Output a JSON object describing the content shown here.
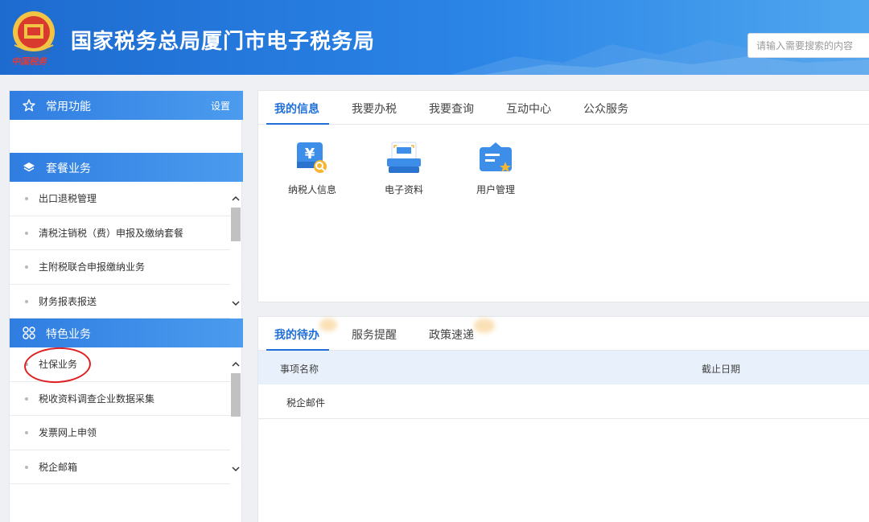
{
  "header": {
    "title": "国家税务总局厦门市电子税务局",
    "emblem_text": "中国税务",
    "search_placeholder": "请输入需要搜索的内容"
  },
  "sidebar": {
    "common": {
      "title": "常用功能",
      "action": "设置",
      "icon": "star-icon"
    },
    "package": {
      "title": "套餐业务",
      "icon": "layers-icon",
      "items": [
        "出口退税管理",
        "清税注销税（费）申报及缴纳套餐",
        "主附税联合申报缴纳业务",
        "财务报表报送"
      ]
    },
    "special": {
      "title": "特色业务",
      "icon": "grid-icon",
      "items": [
        "社保业务",
        "税收资料调查企业数据采集",
        "发票网上申领",
        "税企邮箱"
      ]
    }
  },
  "info_panel": {
    "tabs": [
      "我的信息",
      "我要办税",
      "我要查询",
      "互动中心",
      "公众服务"
    ],
    "active_tab": "我的信息",
    "apps": [
      {
        "label": "纳税人信息",
        "icon": "taxpayer-info-icon"
      },
      {
        "label": "电子资料",
        "icon": "e-document-icon"
      },
      {
        "label": "用户管理",
        "icon": "user-management-icon"
      }
    ]
  },
  "todo_panel": {
    "tabs": [
      "我的待办",
      "服务提醒",
      "政策速递"
    ],
    "active_tab": "我的待办",
    "columns": [
      "事项名称",
      "截止日期"
    ],
    "rows": [
      [
        "税企邮件",
        ""
      ]
    ]
  },
  "colors": {
    "primary": "#1f6fd6",
    "header_start": "#1e6bd0",
    "header_end": "#4fa6ef",
    "annotation_red": "#e02020"
  }
}
